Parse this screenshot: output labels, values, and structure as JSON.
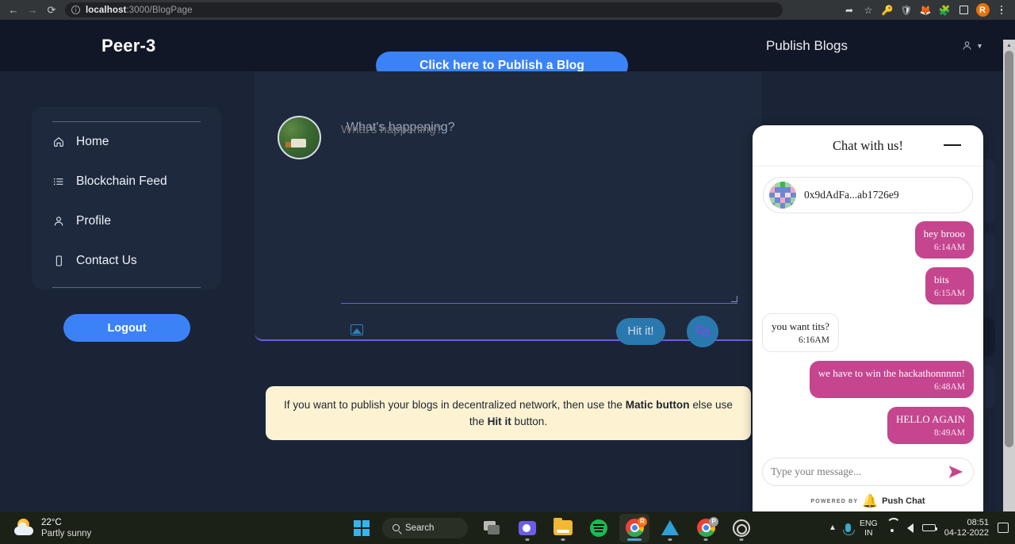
{
  "browser": {
    "back_icon": "back-arrow-icon",
    "forward_icon": "forward-arrow-icon",
    "reload_icon": "reload-icon",
    "url_host": "localhost",
    "url_rest": ":3000/BlogPage",
    "toolbar_icons": [
      "share-icon",
      "bookmark-star-icon",
      "password-key-icon",
      "shield-icon",
      "metamask-fox-icon",
      "extensions-puzzle-icon",
      "sidepanel-icon"
    ],
    "profile_initial": "R"
  },
  "app": {
    "brand": "Peer-3",
    "publish_cta": "Click here to Publish a Blog",
    "header_title": "Publish Blogs"
  },
  "sidebar": {
    "items": [
      {
        "label": "Home",
        "icon": "home-icon"
      },
      {
        "label": "Blockchain Feed",
        "icon": "list-icon"
      },
      {
        "label": "Profile",
        "icon": "person-icon"
      },
      {
        "label": "Contact Us",
        "icon": "phone-icon"
      }
    ],
    "logout_label": "Logout"
  },
  "compose": {
    "placeholder": "What's happening?",
    "value": "",
    "image_button": "image-upload-icon",
    "hit_label": "Hit it!",
    "matic_button": "polygon-matic-icon"
  },
  "banner": {
    "part1": "If you want to publish your blogs in decentralized network, then use the ",
    "bold1": "Matic button",
    "part2": " else use the ",
    "bold2": "Hit it",
    "part3": " button."
  },
  "chat": {
    "title": "Chat with us!",
    "minimize_icon": "minimize-icon",
    "contact_address": "0x9dAdFa...ab1726e9",
    "messages": [
      {
        "text": "hey brooo",
        "time": "6:14AM",
        "direction": "out"
      },
      {
        "text": "bits",
        "time": "6:15AM",
        "direction": "out"
      },
      {
        "text": "you want tits?",
        "time": "6:16AM",
        "direction": "in"
      },
      {
        "text": "we have to win the hackathonnnnn!",
        "time": "6:48AM",
        "direction": "out"
      },
      {
        "text": "HELLO AGAIN",
        "time": "8:49AM",
        "direction": "out"
      }
    ],
    "input_placeholder": "Type your message...",
    "send_icon": "send-paper-plane-icon",
    "powered_by": "POWERED BY",
    "provider": "Push Chat",
    "accent_color": "#c6458f"
  },
  "taskbar": {
    "weather_temp": "22°C",
    "weather_desc": "Partly sunny",
    "search_label": "Search",
    "apps": [
      "start-windows-icon",
      "task-view-icon",
      "teams-icon",
      "file-explorer-icon",
      "spotify-icon",
      "chrome-icon",
      "vscode-icon",
      "chrome-beta-icon",
      "obs-icon"
    ],
    "tray": {
      "language": "ENG",
      "region": "IN",
      "time": "08:51",
      "date": "04-12-2022"
    }
  },
  "colors": {
    "page_bg": "#1b2437",
    "header_bg": "#111726",
    "card_bg": "#1e293e",
    "accent_blue": "#3b82f6",
    "banner_bg": "#fdf3d3",
    "chat_pink": "#c6458f"
  }
}
